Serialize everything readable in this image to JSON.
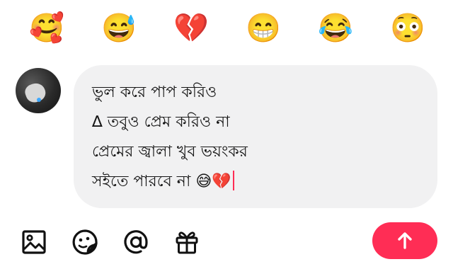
{
  "emoji_bar": {
    "items": [
      {
        "glyph": "🥰",
        "icon": "smiling-face-with-hearts-icon"
      },
      {
        "glyph": "😅",
        "icon": "grinning-sweat-icon"
      },
      {
        "glyph": "💔",
        "icon": "broken-heart-icon"
      },
      {
        "glyph": "😁",
        "icon": "beaming-face-icon"
      },
      {
        "glyph": "😂",
        "icon": "tears-of-joy-icon"
      },
      {
        "glyph": "😳",
        "icon": "flushed-face-icon"
      }
    ]
  },
  "composer": {
    "message_lines": [
      "ভুল করে পাপ করিও",
      "∆ তবুও প্রেম করিও না",
      "প্রেমের জ্বালা খুব ভয়ংকর",
      "সইতে পারবে না 😅💔"
    ]
  },
  "toolbar": {
    "icons": [
      "image-icon",
      "sticker-icon",
      "mention-icon",
      "gift-icon"
    ],
    "send_icon": "arrow-up-icon"
  },
  "colors": {
    "accent": "#ff2d55",
    "bubble_bg": "#f1f1f2",
    "text": "#161616"
  }
}
